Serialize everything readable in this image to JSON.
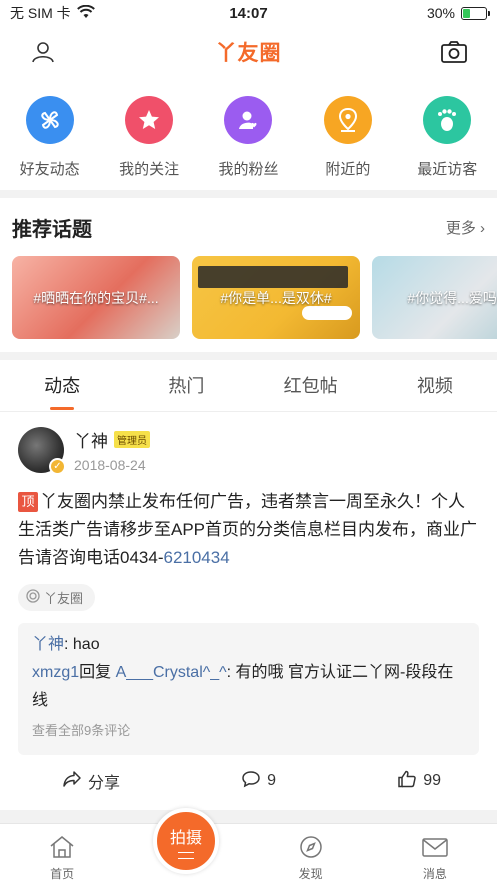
{
  "status_bar": {
    "carrier": "无 SIM 卡",
    "time": "14:07",
    "battery": "30%",
    "battery_level": 0.3
  },
  "header": {
    "title": "丫友圈"
  },
  "quick_entries": [
    {
      "label": "好友动态",
      "icon": "pinwheel-icon",
      "color": "#3a8ff0"
    },
    {
      "label": "我的关注",
      "icon": "star-icon",
      "color": "#f0506a"
    },
    {
      "label": "我的粉丝",
      "icon": "person-heart-icon",
      "color": "#9b5cf0"
    },
    {
      "label": "附近的",
      "icon": "location-pin-icon",
      "color": "#f7a623"
    },
    {
      "label": "最近访客",
      "icon": "footprint-icon",
      "color": "#2cc6a0"
    }
  ],
  "topics": {
    "title": "推荐话题",
    "more": "更多",
    "cards": [
      {
        "caption": "#晒晒在你的宝贝#..."
      },
      {
        "caption": "#你是单...是双休#"
      },
      {
        "caption": "#你觉得...爱吗#"
      }
    ]
  },
  "tabs": [
    {
      "label": "动态",
      "active": true
    },
    {
      "label": "热门",
      "active": false
    },
    {
      "label": "红包帖",
      "active": false
    },
    {
      "label": "视频",
      "active": false
    }
  ],
  "post": {
    "author": "丫神",
    "admin_badge": "管理员",
    "date": "2018-08-24",
    "top_label": "顶",
    "text": "丫友圈内禁止发布任何广告，违者禁言一周至永久！个人生活类广告请移步至APP首页的分类信息栏目内发布，商业广告请咨询电话0434-",
    "phone_tail": "6210434",
    "circle_tag": "丫友圈",
    "comments": [
      {
        "user": "丫神",
        "text": ": hao"
      },
      {
        "user": "xmzg1",
        "reply_word": "回复",
        "reply_to": "A___Crystal^_^",
        "text": ": 有的哦  官方认证二丫网-段段在线"
      }
    ],
    "view_all": "查看全部9条评论",
    "share_label": "分享",
    "comment_count": "9",
    "like_count": "99"
  },
  "bottom_nav": {
    "home": "首页",
    "shoot": "拍摄",
    "discover": "发现",
    "messages": "消息"
  }
}
